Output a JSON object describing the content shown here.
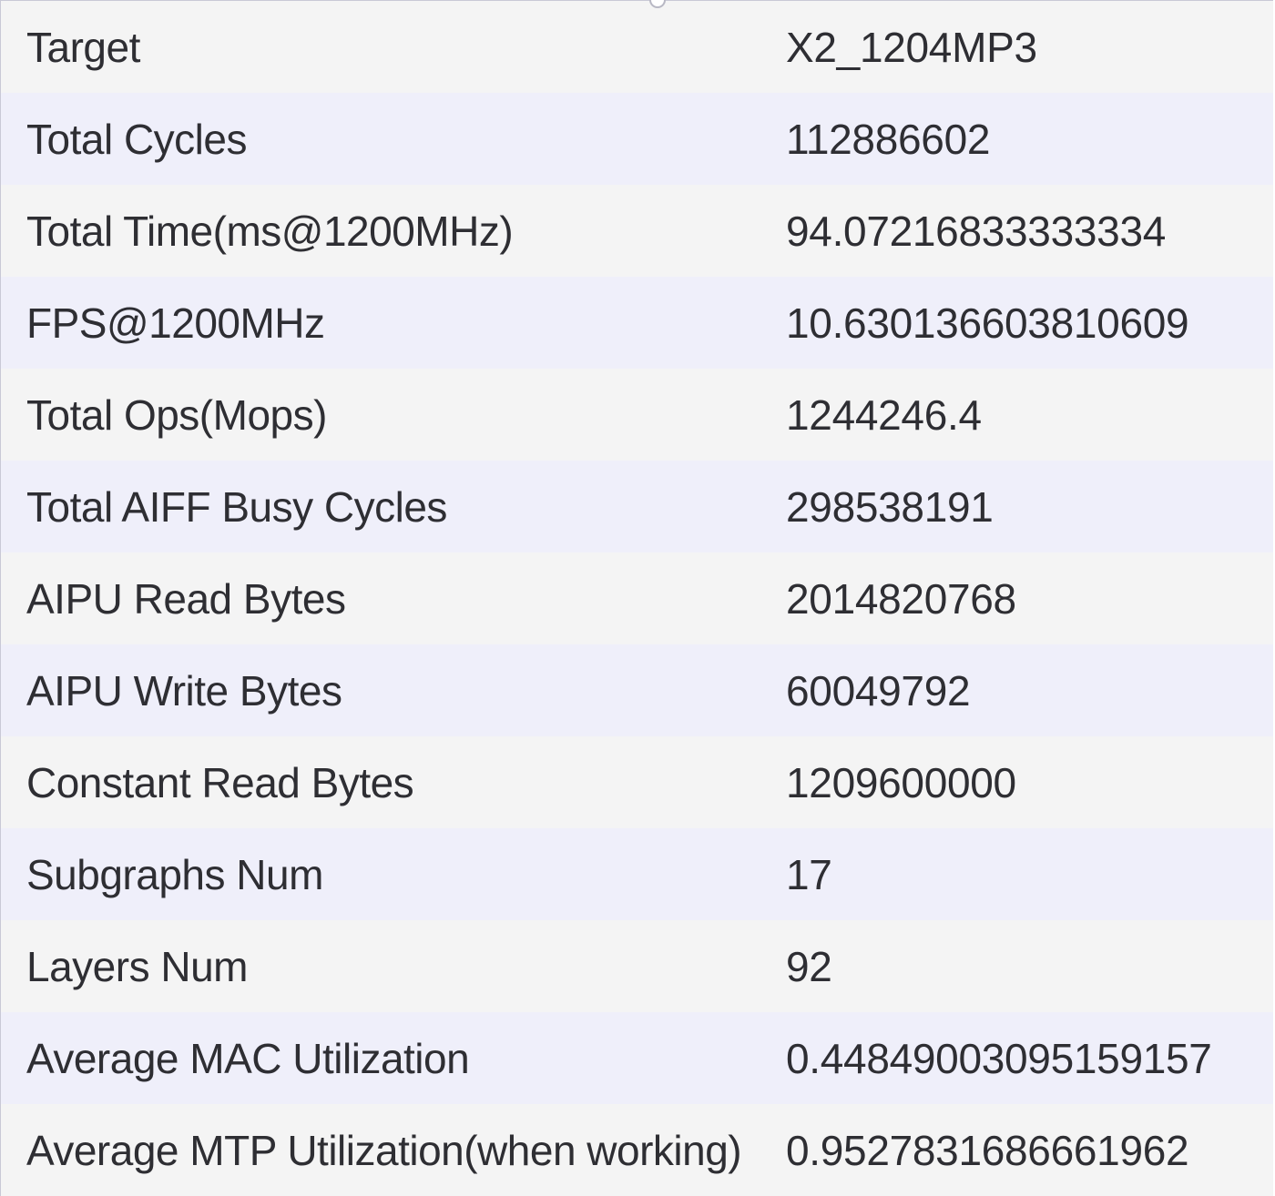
{
  "rows": [
    {
      "key": "Target",
      "value": "X2_1204MP3"
    },
    {
      "key": "Total Cycles",
      "value": "112886602"
    },
    {
      "key": "Total Time(ms@1200MHz)",
      "value": "94.07216833333334"
    },
    {
      "key": "FPS@1200MHz",
      "value": "10.630136603810609"
    },
    {
      "key": "Total Ops(Mops)",
      "value": "1244246.4"
    },
    {
      "key": "Total AIFF Busy Cycles",
      "value": "298538191"
    },
    {
      "key": "AIPU Read Bytes",
      "value": "2014820768"
    },
    {
      "key": "AIPU Write Bytes",
      "value": "60049792"
    },
    {
      "key": "Constant Read Bytes",
      "value": "1209600000"
    },
    {
      "key": "Subgraphs Num",
      "value": "17"
    },
    {
      "key": "Layers Num",
      "value": "92"
    },
    {
      "key": "Average MAC Utilization",
      "value": "0.44849003095159157"
    },
    {
      "key": "Average MTP Utilization(when working)",
      "value": "0.9527831686661962"
    }
  ]
}
